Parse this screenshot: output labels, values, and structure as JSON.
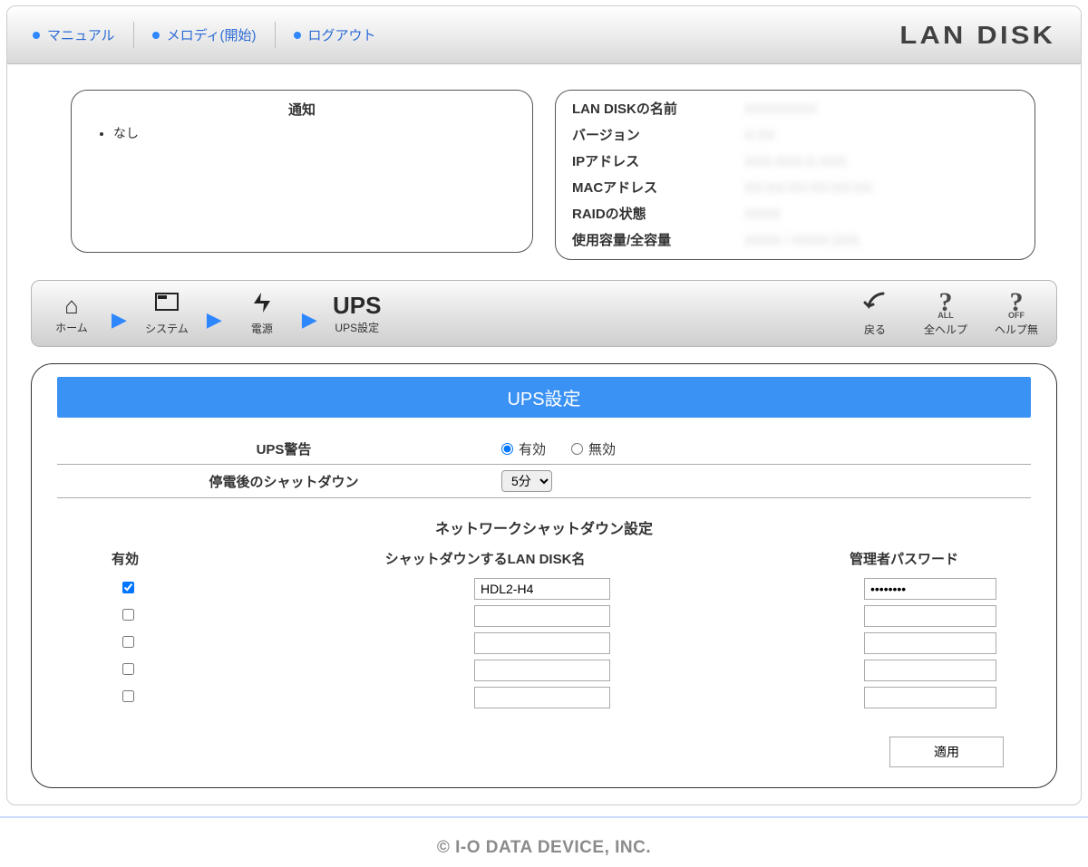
{
  "topbar": {
    "links": {
      "manual": "マニュアル",
      "melody": "メロディ(開始)",
      "logout": "ログアウト"
    },
    "brand": "LAN DISK"
  },
  "notice": {
    "title": "通知",
    "items": [
      "なし"
    ]
  },
  "status": {
    "rows": [
      {
        "label": "LAN DISKの名前",
        "value": "XXXXXXXX"
      },
      {
        "label": "バージョン",
        "value": "X.XX"
      },
      {
        "label": "IPアドレス",
        "value": "XXX.XXX.X.XXX"
      },
      {
        "label": "MACアドレス",
        "value": "XX:XX:XX:XX:XX:XX"
      },
      {
        "label": "RAIDの状態",
        "value": "XXXX"
      },
      {
        "label": "使用容量/全容量",
        "value": "XXXX / XXXX (XX)"
      }
    ]
  },
  "breadcrumb": {
    "home": "ホーム",
    "system": "システム",
    "power": "電源",
    "ups_text": "UPS",
    "ups": "UPS設定",
    "back": "戻る",
    "help_all": "全ヘルプ",
    "help_all_sub": "ALL",
    "help_off": "ヘルプ無",
    "help_off_sub": "OFF"
  },
  "settings": {
    "title": "UPS設定",
    "ups_warning": {
      "label": "UPS警告",
      "enable": "有効",
      "disable": "無効",
      "selected": "enable"
    },
    "shutdown_delay": {
      "label": "停電後のシャットダウン",
      "value": "5分",
      "options": [
        "5分"
      ]
    },
    "network_shutdown": {
      "title": "ネットワークシャットダウン設定",
      "cols": {
        "enable": "有効",
        "name": "シャットダウンするLAN DISK名",
        "pass": "管理者パスワード"
      },
      "rows": [
        {
          "enabled": true,
          "name": "HDL2-H4",
          "pass": "********"
        },
        {
          "enabled": false,
          "name": "",
          "pass": ""
        },
        {
          "enabled": false,
          "name": "",
          "pass": ""
        },
        {
          "enabled": false,
          "name": "",
          "pass": ""
        },
        {
          "enabled": false,
          "name": "",
          "pass": ""
        }
      ]
    },
    "apply": "適用"
  },
  "footer": "© I-O DATA DEVICE, INC."
}
